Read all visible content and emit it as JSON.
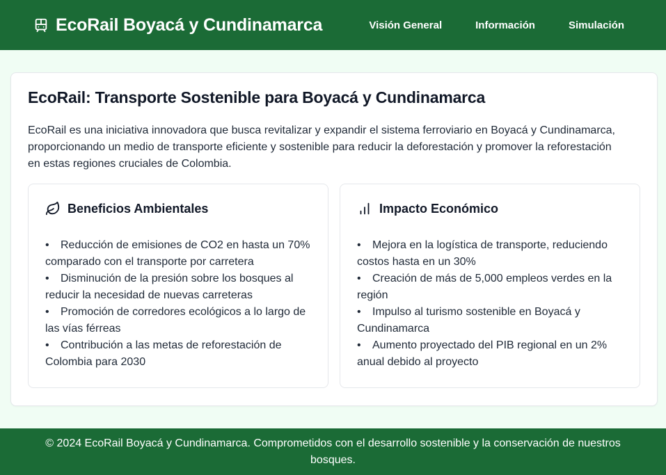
{
  "header": {
    "brand_icon": "train-icon",
    "title": "EcoRail Boyacá y Cundinamarca",
    "nav": [
      {
        "label": "Visión General"
      },
      {
        "label": "Información"
      },
      {
        "label": "Simulación"
      }
    ]
  },
  "main": {
    "title": "EcoRail: Transporte Sostenible para Boyacá y Cundinamarca",
    "intro": "EcoRail es una iniciativa innovadora que busca revitalizar y expandir el sistema ferroviario en Boyacá y Cundinamarca, proporcionando un medio de transporte eficiente y sostenible para reducir la deforestación y promover la reforestación en estas regiones cruciales de Colombia.",
    "panels": [
      {
        "icon": "leaf-icon",
        "title": "Beneficios Ambientales",
        "items": [
          "Reducción de emisiones de CO2 en hasta un 70% comparado con el transporte por carretera",
          "Disminución de la presión sobre los bosques al reducir la necesidad de nuevas carreteras",
          "Promoción de corredores ecológicos a lo largo de las vías férreas",
          "Contribución a las metas de reforestación de Colombia para 2030"
        ]
      },
      {
        "icon": "bar-chart-icon",
        "title": "Impacto Económico",
        "items": [
          "Mejora en la logística de transporte, reduciendo costos hasta en un 30%",
          "Creación de más de 5,000 empleos verdes en la región",
          "Impulso al turismo sostenible en Boyacá y Cundinamarca",
          "Aumento proyectado del PIB regional en un 2% anual debido al proyecto"
        ]
      }
    ]
  },
  "footer": {
    "text": "© 2024 EcoRail Boyacá y Cundinamarca. Comprometidos con el desarrollo sostenible y la conservación de nuestros bosques."
  },
  "colors": {
    "header_bg": "#1b6b36",
    "page_bg": "#f0fdf4",
    "card_bg": "#ffffff"
  }
}
